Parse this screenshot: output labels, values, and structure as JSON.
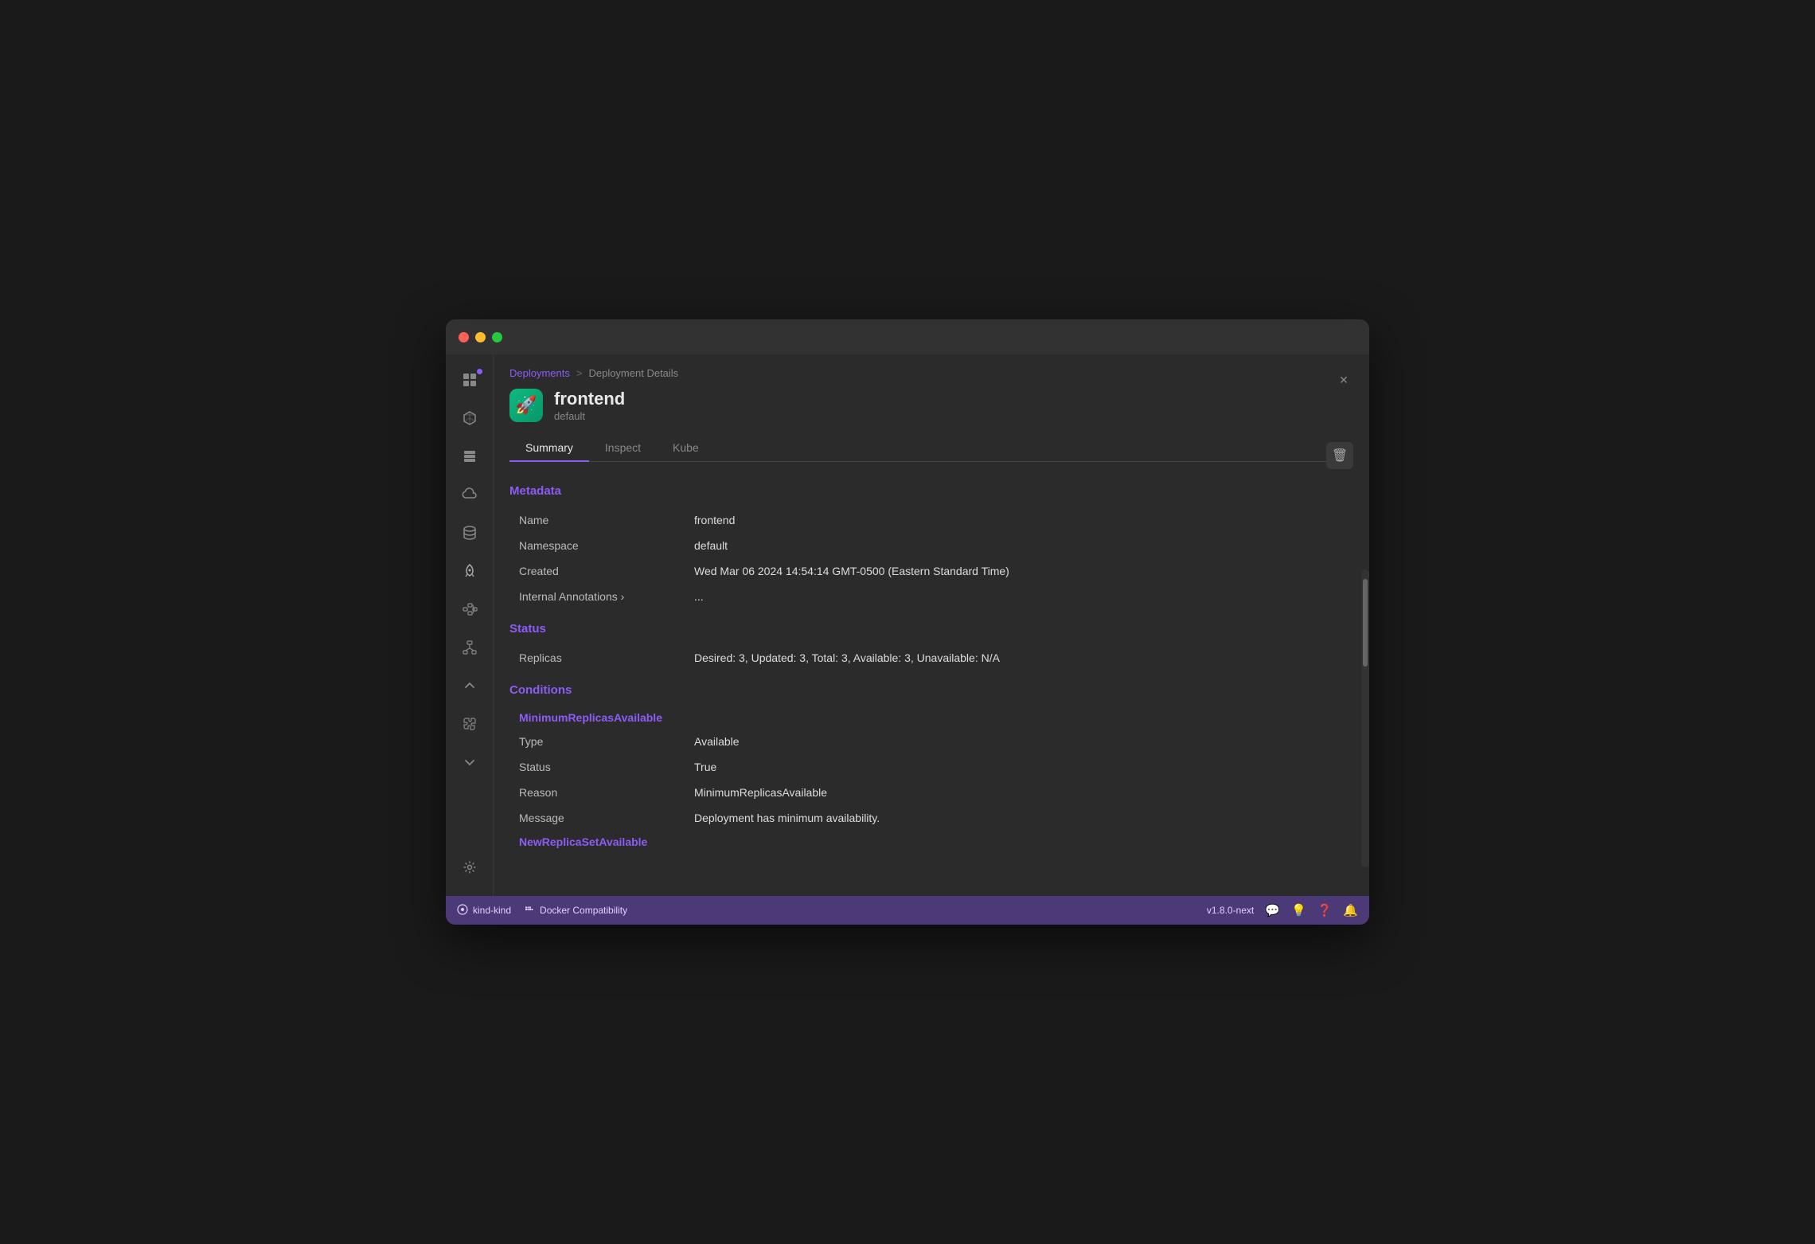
{
  "window": {
    "title": "Deployment Details"
  },
  "trafficLights": {
    "red": "close",
    "yellow": "minimize",
    "green": "maximize"
  },
  "sidebar": {
    "icons": [
      {
        "name": "grid-icon",
        "symbol": "⊞",
        "active": false,
        "badge": true
      },
      {
        "name": "cube-icon",
        "symbol": "◻",
        "active": false,
        "badge": false
      },
      {
        "name": "stack-icon",
        "symbol": "⧉",
        "active": false,
        "badge": false
      },
      {
        "name": "cloud-icon",
        "symbol": "☁",
        "active": false,
        "badge": false
      },
      {
        "name": "database-icon",
        "symbol": "⬡",
        "active": false,
        "badge": false
      },
      {
        "name": "rocket-icon",
        "symbol": "🚀",
        "active": true,
        "badge": false
      },
      {
        "name": "diagram-icon",
        "symbol": "⊟",
        "active": false,
        "badge": false
      },
      {
        "name": "network-icon",
        "symbol": "⬢",
        "active": false,
        "badge": false
      },
      {
        "name": "collapse-icon",
        "symbol": "∧",
        "active": false,
        "badge": false
      },
      {
        "name": "puzzle-icon",
        "symbol": "⌘",
        "active": false,
        "badge": false
      },
      {
        "name": "expand-icon",
        "symbol": "∨",
        "active": false,
        "badge": false
      },
      {
        "name": "gear-icon",
        "symbol": "⚙",
        "active": false,
        "badge": false
      }
    ]
  },
  "breadcrumb": {
    "link": "Deployments",
    "separator": ">",
    "current": "Deployment Details"
  },
  "app": {
    "icon": "🚀",
    "name": "frontend",
    "namespace": "default"
  },
  "tabs": [
    {
      "id": "summary",
      "label": "Summary",
      "active": true
    },
    {
      "id": "inspect",
      "label": "Inspect",
      "active": false
    },
    {
      "id": "kube",
      "label": "Kube",
      "active": false
    }
  ],
  "sections": {
    "metadata": {
      "title": "Metadata",
      "fields": [
        {
          "label": "Name",
          "value": "frontend",
          "type": "text"
        },
        {
          "label": "Namespace",
          "value": "default",
          "type": "text"
        },
        {
          "label": "Created",
          "value": "Wed Mar 06 2024 14:54:14 GMT-0500 (Eastern Standard Time)",
          "type": "text"
        },
        {
          "label": "Internal Annotations ›",
          "value": "...",
          "type": "expandable"
        }
      ]
    },
    "status": {
      "title": "Status",
      "fields": [
        {
          "label": "Replicas",
          "value": "Desired: 3, Updated: 3, Total: 3, Available: 3, Unavailable: N/A",
          "type": "text"
        }
      ]
    },
    "conditions": {
      "title": "Conditions",
      "subsections": [
        {
          "name": "MinimumReplicasAvailable",
          "fields": [
            {
              "label": "Type",
              "value": "Available",
              "type": "text"
            },
            {
              "label": "Status",
              "value": "True",
              "type": "text"
            },
            {
              "label": "Reason",
              "value": "MinimumReplicasAvailable",
              "type": "text"
            },
            {
              "label": "Message",
              "value": "Deployment has minimum availability.",
              "type": "text"
            }
          ]
        }
      ],
      "truncated": "NewReplicaSetAvailable"
    }
  },
  "statusBar": {
    "clusterName": "kind-kind",
    "dockerLabel": "Docker Compatibility",
    "version": "v1.8.0-next",
    "icons": [
      "chat",
      "bulb",
      "question",
      "bell"
    ]
  },
  "buttons": {
    "close": "✕",
    "delete": "🗑"
  }
}
